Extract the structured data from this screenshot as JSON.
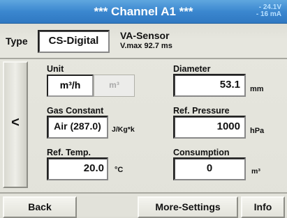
{
  "header": {
    "title": "*** Channel A1 ***",
    "voltage": "- 24.1V",
    "current": "- 16 mA"
  },
  "type_row": {
    "label": "Type",
    "value": "CS-Digital",
    "sensor_name": "VA-Sensor",
    "vmax": "V.max 92.7 ms"
  },
  "nav": {
    "back_arrow": "<"
  },
  "unit": {
    "label": "Unit",
    "options": [
      "m³/h",
      "m³"
    ],
    "selected": "m³/h"
  },
  "gas_constant": {
    "label": "Gas Constant",
    "value": "Air (287.0)",
    "unit": "J/Kg*k"
  },
  "ref_temp": {
    "label": "Ref. Temp.",
    "value": "20.0",
    "unit": "°C"
  },
  "diameter": {
    "label": "Diameter",
    "value": "53.1",
    "unit": "mm"
  },
  "ref_pressure": {
    "label": "Ref. Pressure",
    "value": "1000",
    "unit": "hPa"
  },
  "consumption": {
    "label": "Consumption",
    "value": "0",
    "unit": "m³"
  },
  "footer": {
    "back": "Back",
    "more_settings": "More-Settings",
    "info": "Info"
  },
  "colors": {
    "title_bar": "#3b87cf",
    "background": "#dcdcd4",
    "status_text": "#b7e0ff"
  }
}
